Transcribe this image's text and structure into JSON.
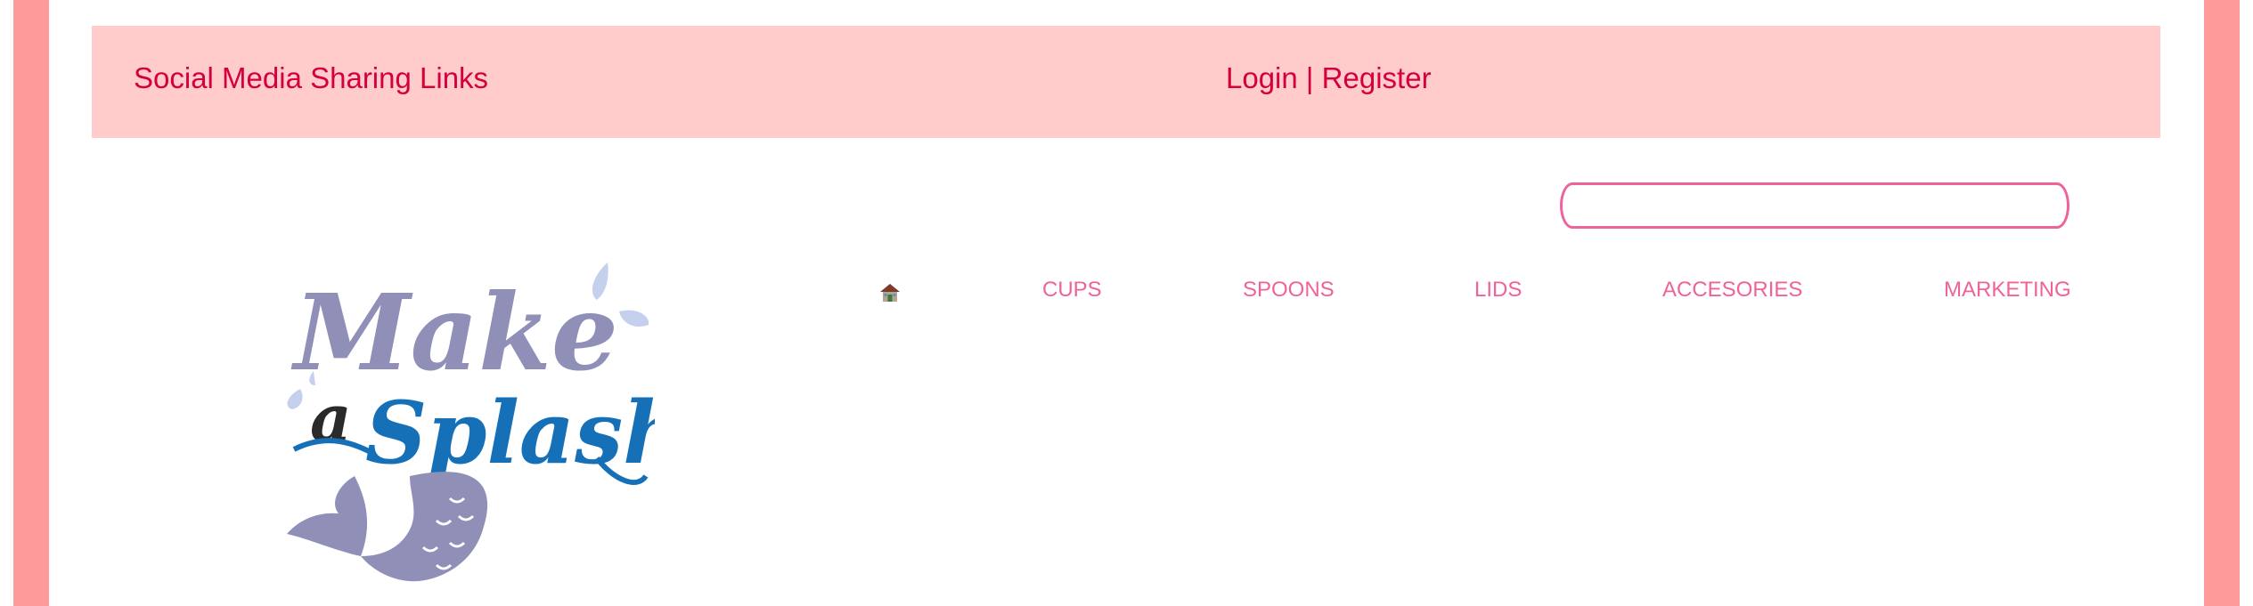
{
  "colors": {
    "frame": "#ff9a9a",
    "topbar_bg": "#ffcbcb",
    "topbar_text": "#d4003c",
    "nav_text": "#f0629a",
    "search_border": "#f0629a",
    "logo_lavender": "#8f8fb8",
    "logo_blue": "#1570b8",
    "logo_dark": "#2a2a2a",
    "logo_splash": "#c5d0ee"
  },
  "topbar": {
    "social_text": "Social Media Sharing Links",
    "login_label": "Login",
    "separator": "|",
    "register_label": "Register"
  },
  "search": {
    "value": "",
    "placeholder": ""
  },
  "nav": {
    "home_icon": "house-icon",
    "items": [
      {
        "label": "CUPS"
      },
      {
        "label": "SPOONS"
      },
      {
        "label": "LIDS"
      },
      {
        "label": "ACCESORIES"
      },
      {
        "label": "MARKETING"
      }
    ]
  },
  "logo": {
    "line1": "Make",
    "line2_a": "a",
    "line2_b": "Splash"
  }
}
